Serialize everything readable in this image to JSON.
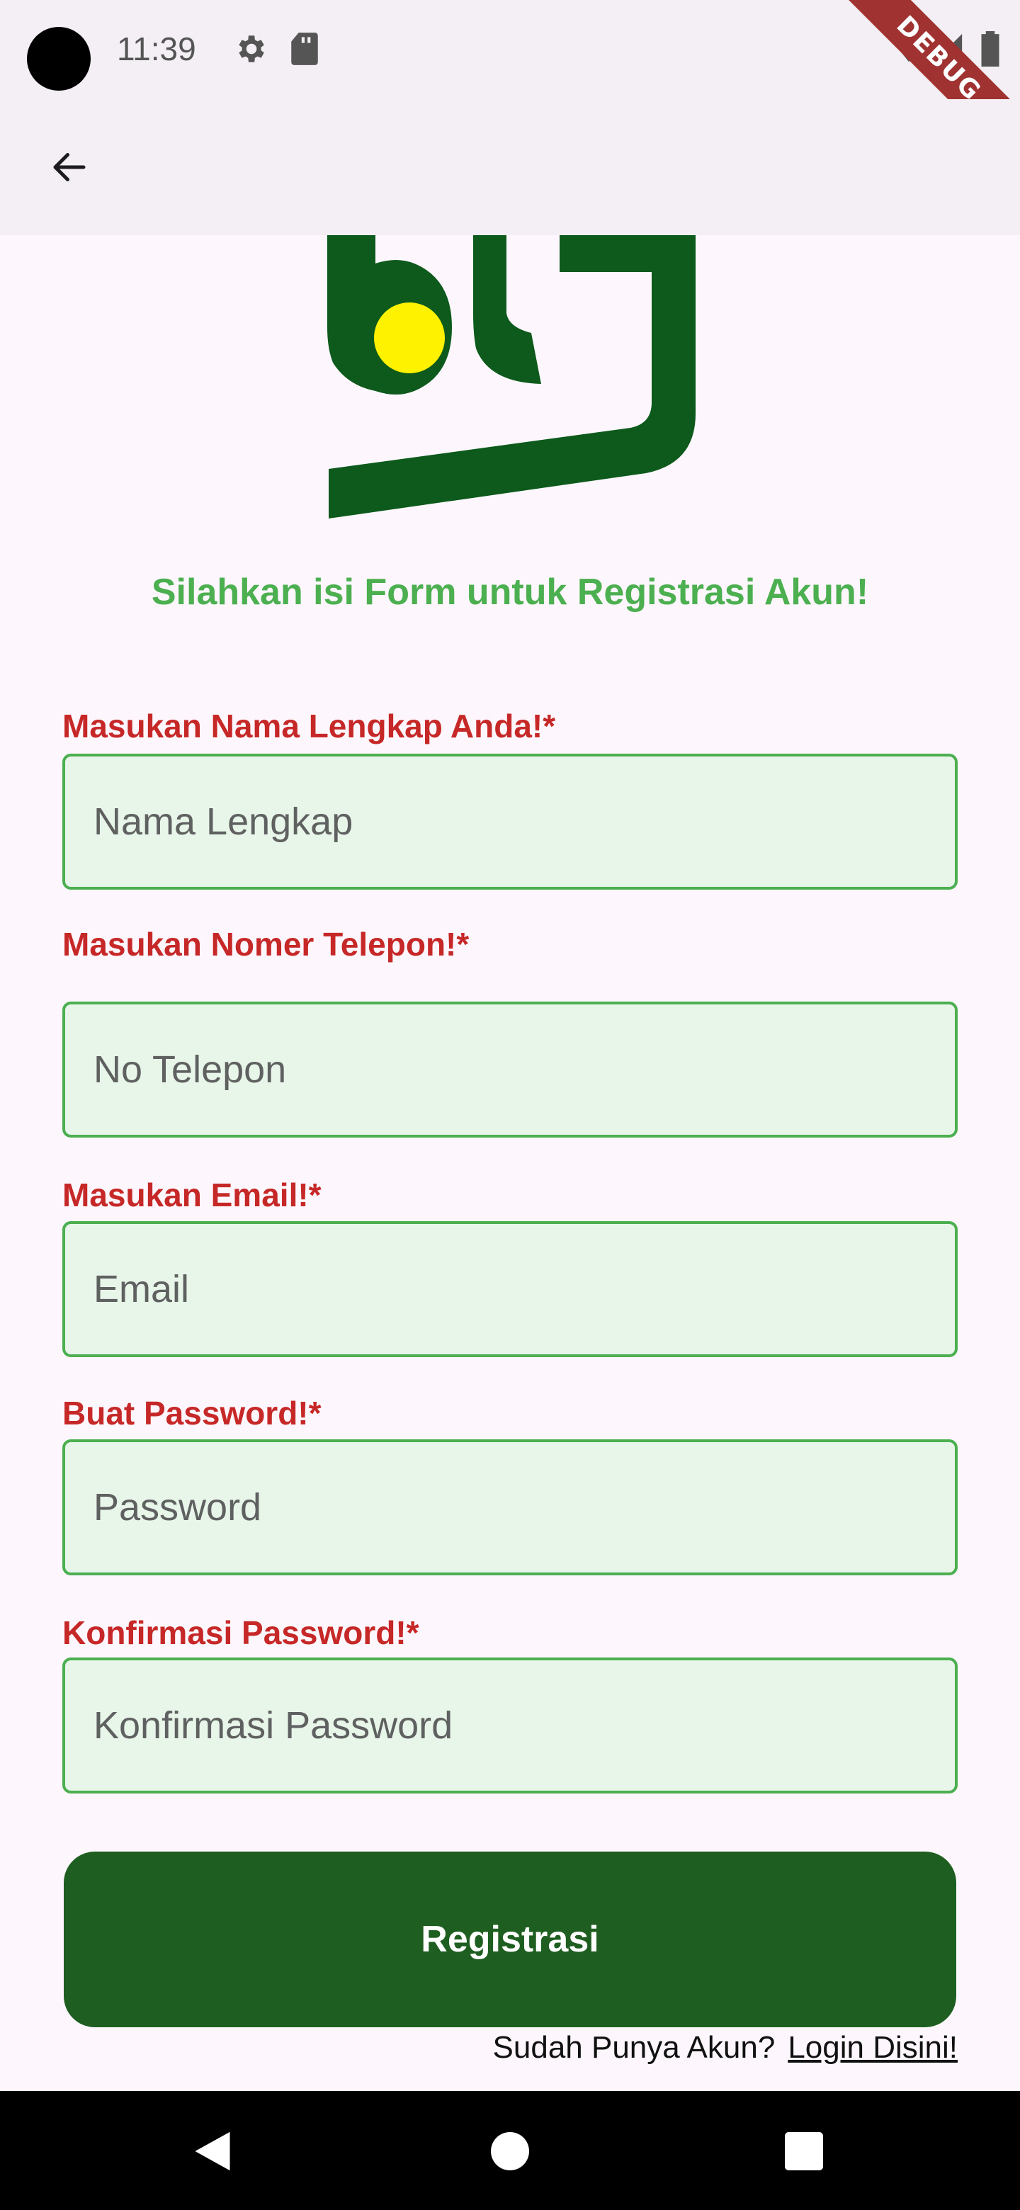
{
  "status_bar": {
    "time": "11:39"
  },
  "debug_banner": "DEBUG",
  "form": {
    "headline": "Silahkan isi Form untuk Registrasi Akun!",
    "fields": [
      {
        "label": "Masukan Nama Lengkap Anda!*",
        "placeholder": "Nama Lengkap"
      },
      {
        "label": "Masukan Nomer Telepon!*",
        "placeholder": "No Telepon"
      },
      {
        "label": "Masukan Email!*",
        "placeholder": "Email"
      },
      {
        "label": "Buat Password!*",
        "placeholder": "Password"
      },
      {
        "label": "Konfirmasi Password!*",
        "placeholder": "Konfirmasi Password"
      }
    ],
    "submit_label": "Registrasi",
    "login_prompt": "Sudah Punya Akun?",
    "login_link": "Login Disini!"
  },
  "colors": {
    "accent_green": "#4caf50",
    "label_red": "#c62828",
    "button_green": "#1e5e20",
    "field_bg": "#e8f5e9",
    "logo_green": "#0d5a1c",
    "logo_yellow": "#fff200"
  },
  "icons": [
    "settings-icon",
    "sd-card-icon",
    "wifi-icon",
    "signal-icon",
    "battery-icon",
    "back-arrow-icon",
    "nav-back-icon",
    "nav-home-icon",
    "nav-recents-icon"
  ]
}
